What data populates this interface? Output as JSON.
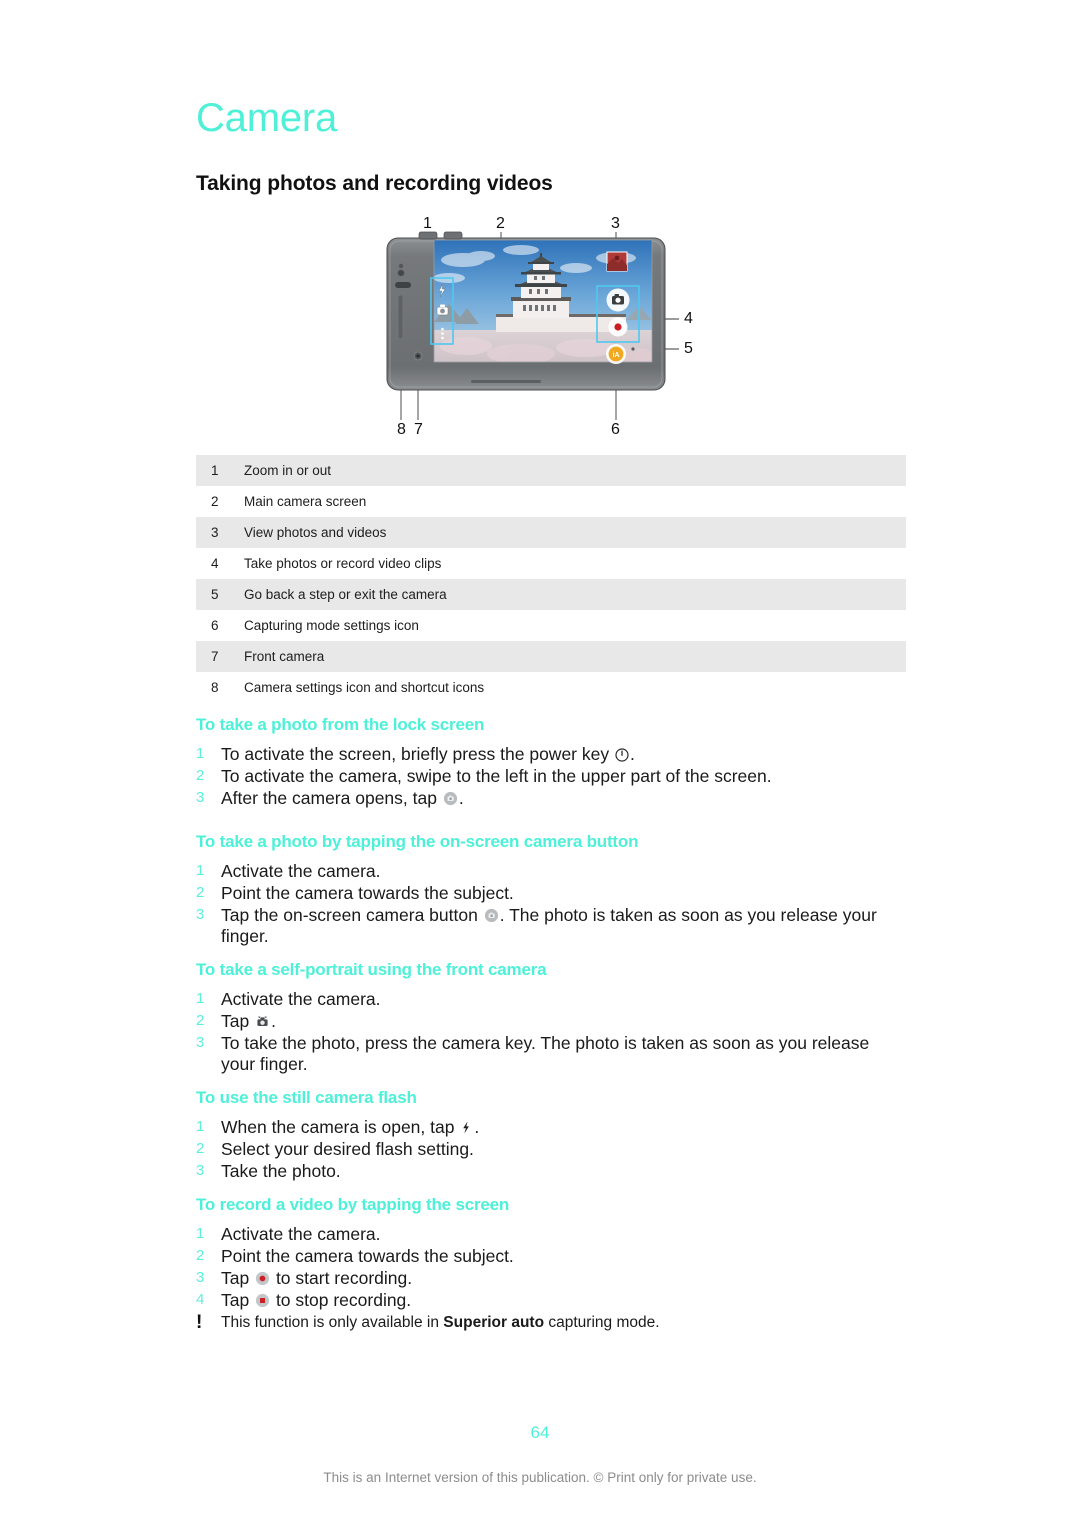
{
  "document": {
    "chapter_title": "Camera",
    "section_title": "Taking photos and recording videos",
    "accent_color": "#4ef0d8",
    "page_number": "64",
    "footer_note": "This is an Internet version of this publication. © Print only for private use."
  },
  "figure": {
    "name": "camera-overview-diagram",
    "callouts": [
      "1",
      "2",
      "3",
      "4",
      "5",
      "6",
      "7",
      "8"
    ],
    "screen_icons": [
      "flash-icon",
      "switch-camera-icon",
      "more-options-icon",
      "shutter-button-icon",
      "record-button-icon",
      "capture-mode-icon",
      "thumbnail-icon"
    ]
  },
  "legend": {
    "rows": [
      {
        "num": "1",
        "text": "Zoom in or out"
      },
      {
        "num": "2",
        "text": "Main camera screen"
      },
      {
        "num": "3",
        "text": "View photos and videos"
      },
      {
        "num": "4",
        "text": "Take photos or record video clips"
      },
      {
        "num": "5",
        "text": "Go back a step or exit the camera"
      },
      {
        "num": "6",
        "text": "Capturing mode settings icon"
      },
      {
        "num": "7",
        "text": "Front camera"
      },
      {
        "num": "8",
        "text": "Camera settings icon and shortcut icons"
      }
    ]
  },
  "procedures": [
    {
      "title": "To take a photo from the lock screen",
      "steps": [
        {
          "num": "1",
          "pre": "To activate the screen, briefly press the power key ",
          "icon": "power-key-icon",
          "post": "."
        },
        {
          "num": "2",
          "pre": "To activate the camera, swipe to the left in the upper part of the screen.",
          "icon": "",
          "post": ""
        },
        {
          "num": "3",
          "pre": "After the camera opens, tap ",
          "icon": "shutter-button-icon",
          "post": "."
        }
      ]
    },
    {
      "title": "To take a photo by tapping the on-screen camera button",
      "steps": [
        {
          "num": "1",
          "pre": "Activate the camera.",
          "icon": "",
          "post": ""
        },
        {
          "num": "2",
          "pre": "Point the camera towards the subject.",
          "icon": "",
          "post": ""
        },
        {
          "num": "3",
          "pre": "Tap the on-screen camera button ",
          "icon": "shutter-button-icon",
          "post": ". The photo is taken as soon as you release your finger."
        }
      ]
    },
    {
      "title": "To take a self-portrait using the front camera",
      "steps": [
        {
          "num": "1",
          "pre": "Activate the camera.",
          "icon": "",
          "post": ""
        },
        {
          "num": "2",
          "pre": "Tap ",
          "icon": "switch-camera-icon",
          "post": "."
        },
        {
          "num": "3",
          "pre": "To take the photo, press the camera key. The photo is taken as soon as you release your finger.",
          "icon": "",
          "post": ""
        }
      ]
    },
    {
      "title": "To use the still camera flash",
      "steps": [
        {
          "num": "1",
          "pre": "When the camera is open, tap ",
          "icon": "flash-icon",
          "post": "."
        },
        {
          "num": "2",
          "pre": "Select your desired flash setting.",
          "icon": "",
          "post": ""
        },
        {
          "num": "3",
          "pre": "Take the photo.",
          "icon": "",
          "post": ""
        }
      ]
    },
    {
      "title": "To record a video by tapping the screen",
      "steps": [
        {
          "num": "1",
          "pre": "Activate the camera.",
          "icon": "",
          "post": ""
        },
        {
          "num": "2",
          "pre": "Point the camera towards the subject.",
          "icon": "",
          "post": ""
        },
        {
          "num": "3",
          "pre": "Tap ",
          "icon": "record-button-icon",
          "post": " to start recording."
        },
        {
          "num": "4",
          "pre": "Tap ",
          "icon": "stop-button-icon",
          "post": " to stop recording."
        }
      ]
    }
  ],
  "note": {
    "marker": "!",
    "text_before": "This function is only available in ",
    "text_bold": "Superior auto",
    "text_after": " capturing mode."
  }
}
